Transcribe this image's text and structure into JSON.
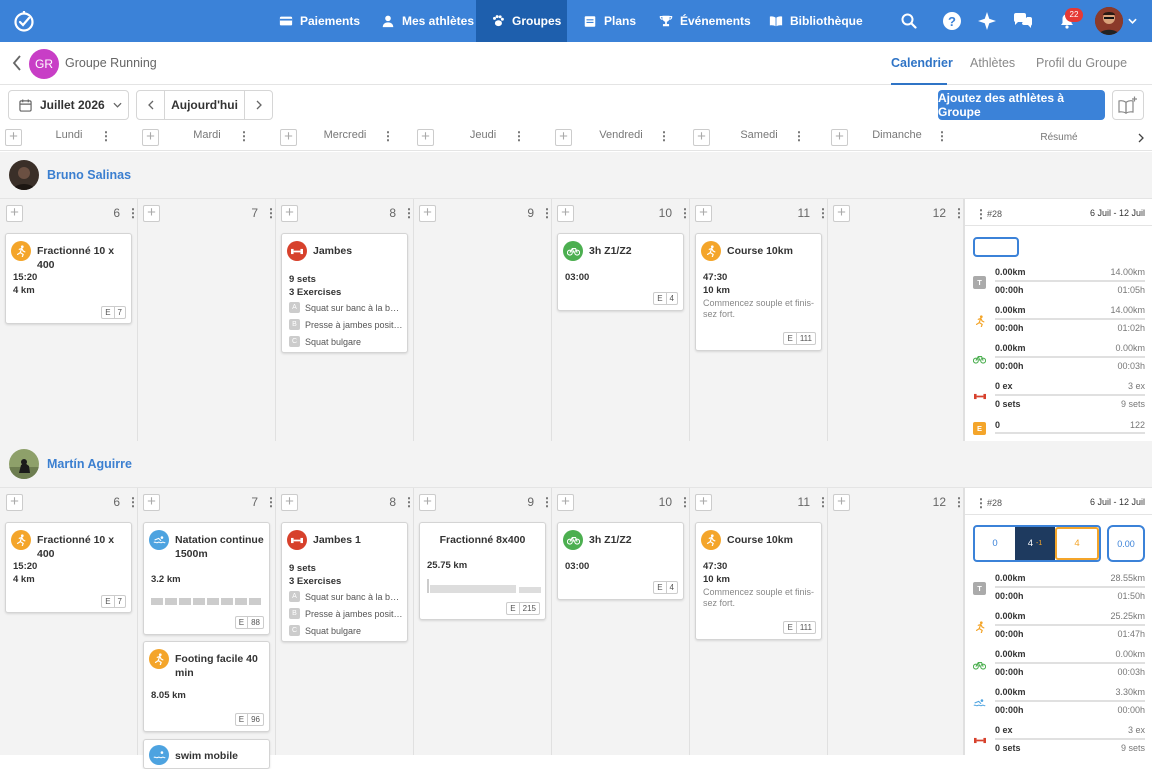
{
  "nav": {
    "items": [
      {
        "label": "Paiements"
      },
      {
        "label": "Mes athlètes"
      },
      {
        "label": "Groupes"
      },
      {
        "label": "Plans"
      },
      {
        "label": "Événements"
      },
      {
        "label": "Bibliothèque"
      }
    ],
    "notif_count": "22",
    "help": "?"
  },
  "group": {
    "initials": "GR",
    "name": "Groupe Running"
  },
  "subtabs": [
    "Calendrier",
    "Athlètes",
    "Profil du Groupe"
  ],
  "toolbar": {
    "month": "Juillet 2026",
    "today": "Aujourd'hui",
    "add_label": "Ajoutez des athlètes à Groupe"
  },
  "days": [
    "Lundi",
    "Mardi",
    "Mercredi",
    "Jeudi",
    "Vendredi",
    "Samedi",
    "Dimanche"
  ],
  "summary_label": "Résumé",
  "date_numbers": [
    "6",
    "7",
    "8",
    "9",
    "10",
    "11",
    "12"
  ],
  "athletes": [
    {
      "name": "Bruno Salinas",
      "week": "#28",
      "range": "6 Juil - 12 Juil",
      "cards": {
        "mon": {
          "title": "Fractionné 10 x 400",
          "l1": "15:20",
          "l2": "4 km",
          "tag": [
            "E",
            "7"
          ]
        },
        "wed": {
          "title": "Jambes",
          "l1": "9 sets",
          "l2": "3 Exercises",
          "ex": [
            [
              "A",
              "Squat sur banc à la barre"
            ],
            [
              "B",
              "Presse à jambes position"
            ],
            [
              "C",
              "Squat bulgare"
            ]
          ]
        },
        "fri": {
          "title": "3h Z1/Z2",
          "l1": "03:00",
          "tag": [
            "E",
            "4"
          ]
        },
        "sat": {
          "title": "Course 10km",
          "l1": "47:30",
          "l2": "10 km",
          "desc": "Commencez souple et finis-sez fort.",
          "tag": [
            "E",
            "111"
          ]
        }
      },
      "summary": [
        {
          "icon": "T",
          "a": "0.00km",
          "b": "14.00km",
          "c": "00:00h",
          "d": "01:05h"
        },
        {
          "icon": "run",
          "a": "0.00km",
          "b": "14.00km",
          "c": "00:00h",
          "d": "01:02h"
        },
        {
          "icon": "bike",
          "a": "0.00km",
          "b": "0.00km",
          "c": "00:00h",
          "d": "00:03h"
        },
        {
          "icon": "gym",
          "a": "0 ex",
          "b": "3 ex",
          "c": "0 sets",
          "d": "9 sets"
        },
        {
          "icon": "E",
          "a": "0",
          "b": "122"
        }
      ]
    },
    {
      "name": "Martín Aguirre",
      "week": "#28",
      "range": "6 Juil - 12 Juil",
      "segments": [
        "0",
        "4",
        "-1",
        "4"
      ],
      "pill": "0.00",
      "cards": {
        "mon": {
          "title": "Fractionné 10 x 400",
          "l1": "15:20",
          "l2": "4 km",
          "tag": [
            "E",
            "7"
          ]
        },
        "tue1": {
          "title": "Natation continue 1500m",
          "l1": "3.2 km",
          "tag": [
            "E",
            "88"
          ]
        },
        "tue2": {
          "title": "Footing facile 40 min",
          "l1": "8.05 km",
          "tag": [
            "E",
            "96"
          ]
        },
        "tue3": {
          "title": "swim mobile"
        },
        "wed": {
          "title": "Jambes 1",
          "l1": "9 sets",
          "l2": "3 Exercises",
          "ex": [
            [
              "A",
              "Squat sur banc à la barre"
            ],
            [
              "B",
              "Presse à jambes position"
            ],
            [
              "C",
              "Squat bulgare"
            ]
          ]
        },
        "thu": {
          "title": "Fractionné 8x400",
          "l1": "25.75 km",
          "tag": [
            "E",
            "215"
          ]
        },
        "fri": {
          "title": "3h Z1/Z2",
          "l1": "03:00",
          "tag": [
            "E",
            "4"
          ]
        },
        "sat": {
          "title": "Course 10km",
          "l1": "47:30",
          "l2": "10 km",
          "desc": "Commencez souple et finis-sez fort.",
          "tag": [
            "E",
            "111"
          ]
        }
      },
      "summary": [
        {
          "icon": "T",
          "a": "0.00km",
          "b": "28.55km",
          "c": "00:00h",
          "d": "01:50h"
        },
        {
          "icon": "run",
          "a": "0.00km",
          "b": "25.25km",
          "c": "00:00h",
          "d": "01:47h"
        },
        {
          "icon": "bike",
          "a": "0.00km",
          "b": "0.00km",
          "c": "00:00h",
          "d": "00:03h"
        },
        {
          "icon": "swim",
          "a": "0.00km",
          "b": "3.30km",
          "c": "00:00h",
          "d": "00:00h"
        },
        {
          "icon": "gym",
          "a": "0 ex",
          "b": "3 ex",
          "c": "0 sets",
          "d": "9 sets"
        }
      ]
    }
  ],
  "colors": {
    "primary": "#3b82d8",
    "run": "#f4a52a",
    "gym": "#d7412c",
    "bike": "#4caf50",
    "swim": "#4da3e0",
    "energy": "#f4a52a"
  }
}
